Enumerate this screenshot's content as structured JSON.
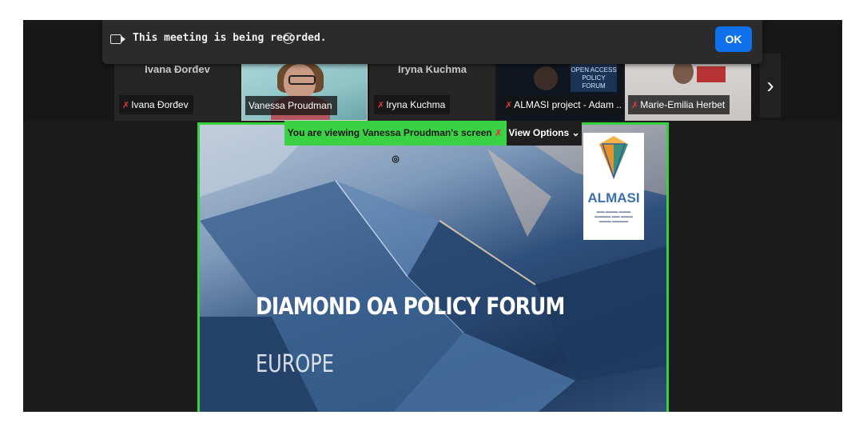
{
  "recording_banner": {
    "text": "This meeting is being recorded.",
    "ok_label": "OK"
  },
  "participants": [
    {
      "tile_name": "Ivana Đorđev",
      "label": "Ivana Đorđev",
      "muted": true
    },
    {
      "tile_name": "",
      "label": "Vanessa Proudman",
      "muted": false,
      "active": true
    },
    {
      "tile_name": "Iryna Kuchma",
      "label": "Iryna Kuchma",
      "muted": true
    },
    {
      "tile_name": "",
      "label": "ALMASI project - Adam ...",
      "muted": true,
      "banner": "OPEN ACCESS POLICY FORUM"
    },
    {
      "tile_name": "",
      "label": "Marie-Emilia Herbet",
      "muted": true
    }
  ],
  "share": {
    "viewing_prefix": "You are viewing",
    "viewing_name": "Vanessa Proudman's screen",
    "view_options_label": "View Options",
    "slide_title": "DIAMOND OA POLICY FORUM",
    "slide_subtitle": "EUROPE",
    "logo_text": "ALMASI"
  },
  "colors": {
    "share_border": "#36d13e",
    "ok_button": "#0e71eb",
    "mic_muted": "#e0393e"
  }
}
